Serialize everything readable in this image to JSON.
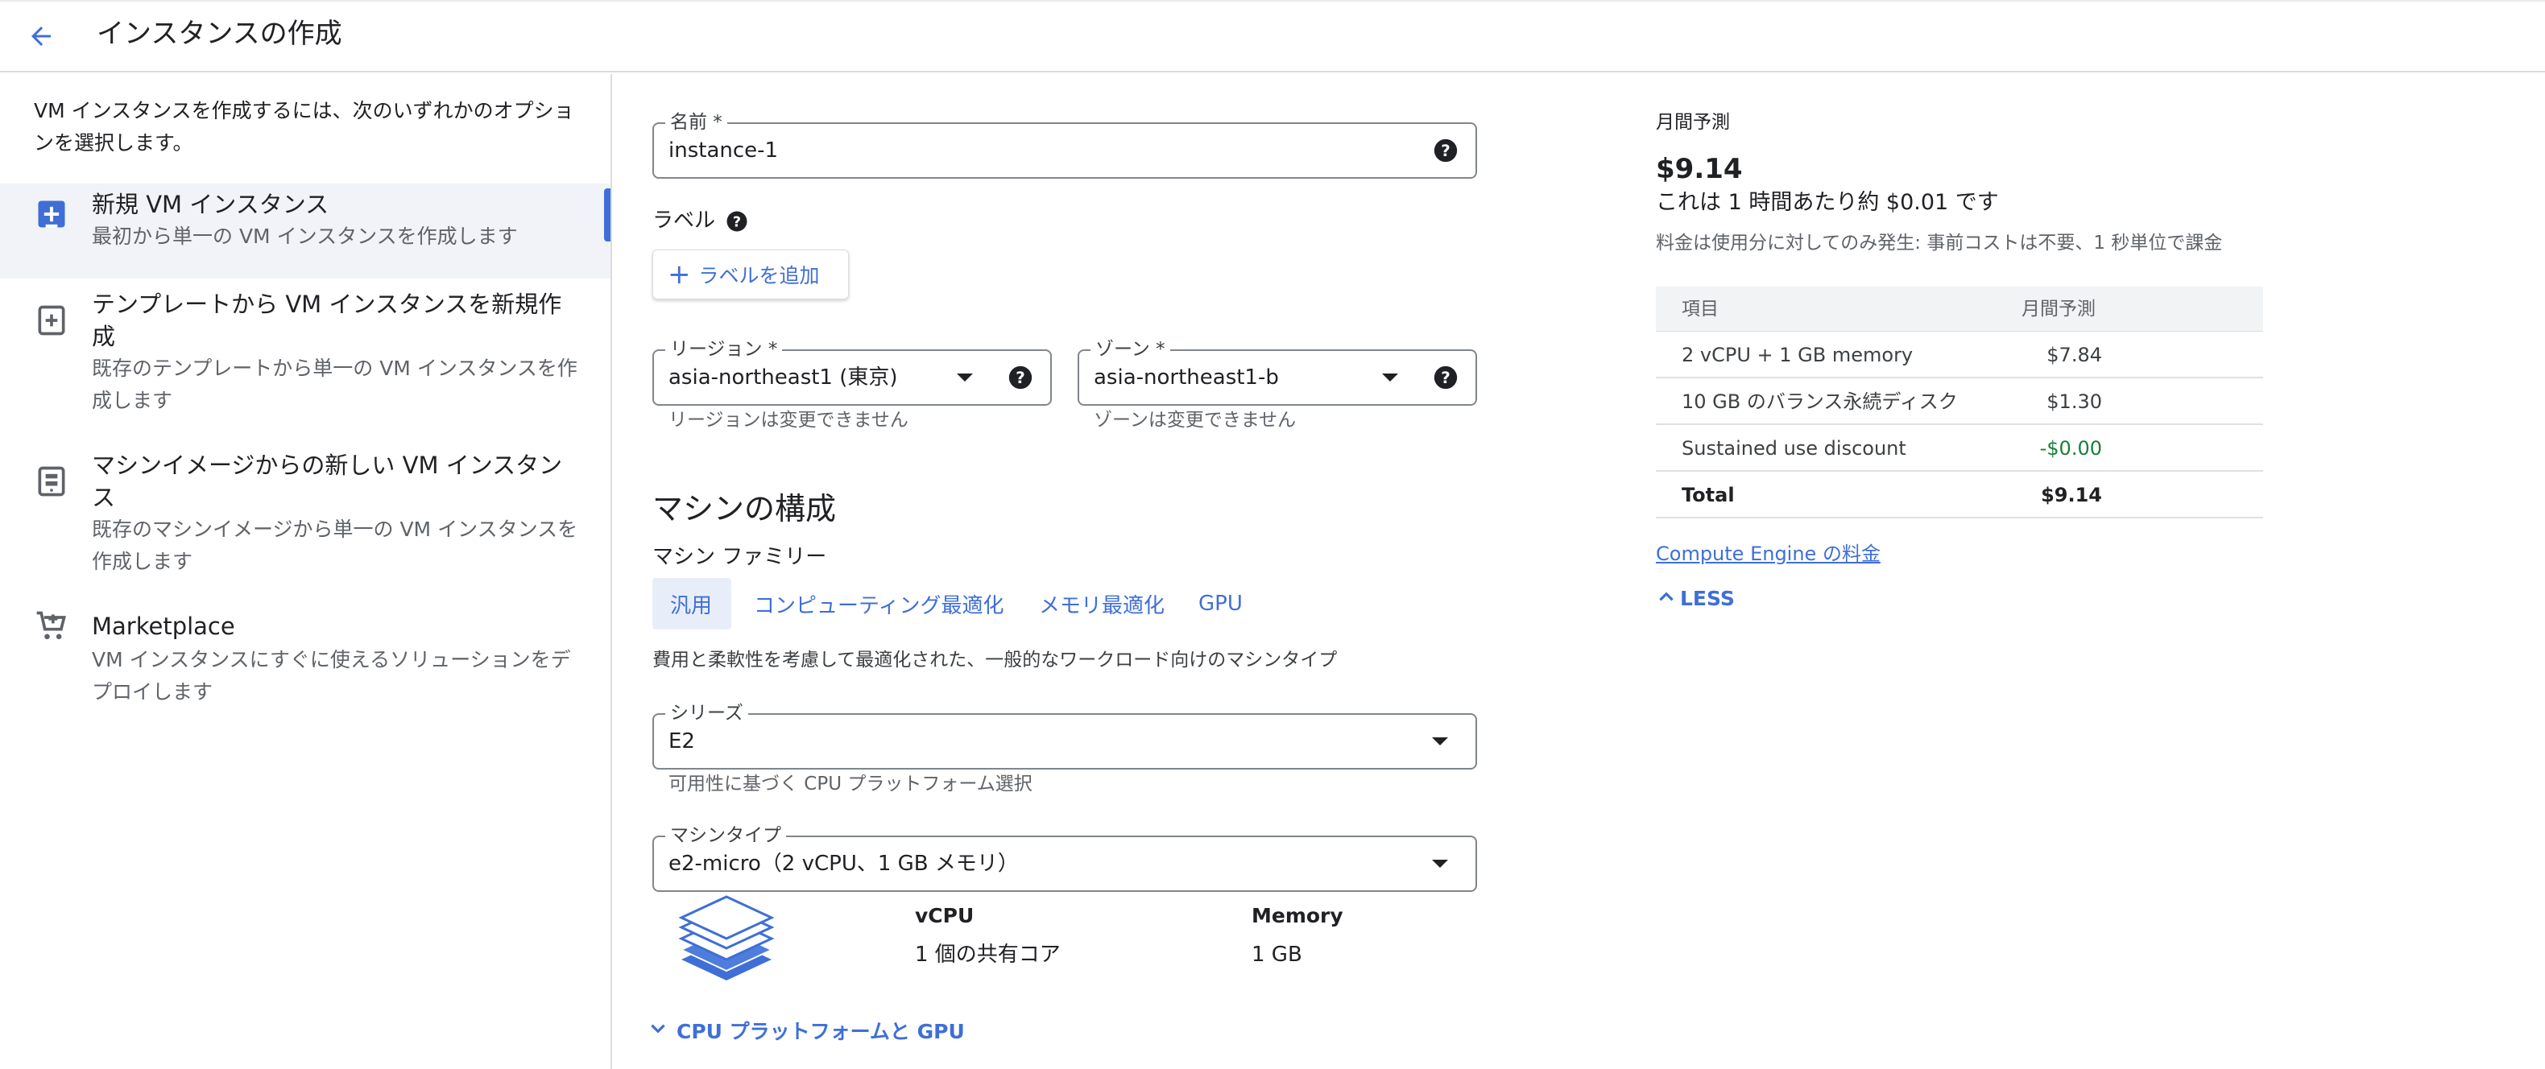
{
  "header": {
    "title": "インスタンスの作成"
  },
  "sidebar": {
    "intro": "VM インスタンスを作成するには、次のいずれかのオプションを選択します。",
    "items": [
      {
        "title": "新規 VM インスタンス",
        "desc": "最初から単一の VM インスタンスを作成します",
        "active": true
      },
      {
        "title": "テンプレートから VM インスタンスを新規作成",
        "desc": "既存のテンプレートから単一の VM インスタンスを作成します"
      },
      {
        "title": "マシンイメージからの新しい VM インスタンス",
        "desc": "既存のマシンイメージから単一の VM インスタンスを作成します"
      },
      {
        "title": "Marketplace",
        "desc": "VM インスタンスにすぐに使えるソリューションをデプロイします"
      }
    ]
  },
  "form": {
    "name": {
      "label": "名前 *",
      "value": "instance-1"
    },
    "labels": {
      "heading": "ラベル",
      "add_button": "ラベルを追加"
    },
    "region": {
      "label": "リージョン *",
      "value": "asia-northeast1 (東京)",
      "hint": "リージョンは変更できません"
    },
    "zone": {
      "label": "ゾーン *",
      "value": "asia-northeast1-b",
      "hint": "ゾーンは変更できません"
    },
    "machine_config": {
      "heading": "マシンの構成",
      "family_label": "マシン ファミリー",
      "tabs": [
        "汎用",
        "コンピューティング最適化",
        "メモリ最適化",
        "GPU"
      ],
      "description": "費用と柔軟性を考慮して最適化された、一般的なワークロード向けのマシンタイプ",
      "series": {
        "label": "シリーズ",
        "value": "E2",
        "hint": "可用性に基づく CPU プラットフォーム選択"
      },
      "machine_type": {
        "label": "マシンタイプ",
        "value": "e2-micro（2 vCPU、1 GB メモリ）"
      },
      "specs": {
        "vcpu_header": "vCPU",
        "vcpu_value": "1 個の共有コア",
        "memory_header": "Memory",
        "memory_value": "1 GB"
      },
      "cpu_toggle": "CPU プラットフォームと GPU"
    }
  },
  "cost": {
    "title": "月間予測",
    "price": "$9.14",
    "hourly": "これは 1 時間あたり約 $0.01 です",
    "note": "料金は使用分に対してのみ発生: 事前コストは不要、1 秒単位で課金",
    "table": {
      "headers": [
        "項目",
        "月間予測"
      ],
      "rows": [
        [
          "2 vCPU + 1 GB memory",
          "$7.84"
        ],
        [
          "10 GB のバランス永続ディスク",
          "$1.30"
        ],
        [
          "Sustained use discount",
          "-$0.00"
        ]
      ],
      "total": [
        "Total",
        "$9.14"
      ]
    },
    "pricing_link": "Compute Engine の料金",
    "less_label": "LESS"
  },
  "colors": {
    "accent": "#3f6fd6",
    "discount": "#188038",
    "active_bg": "#f1f3f8"
  }
}
